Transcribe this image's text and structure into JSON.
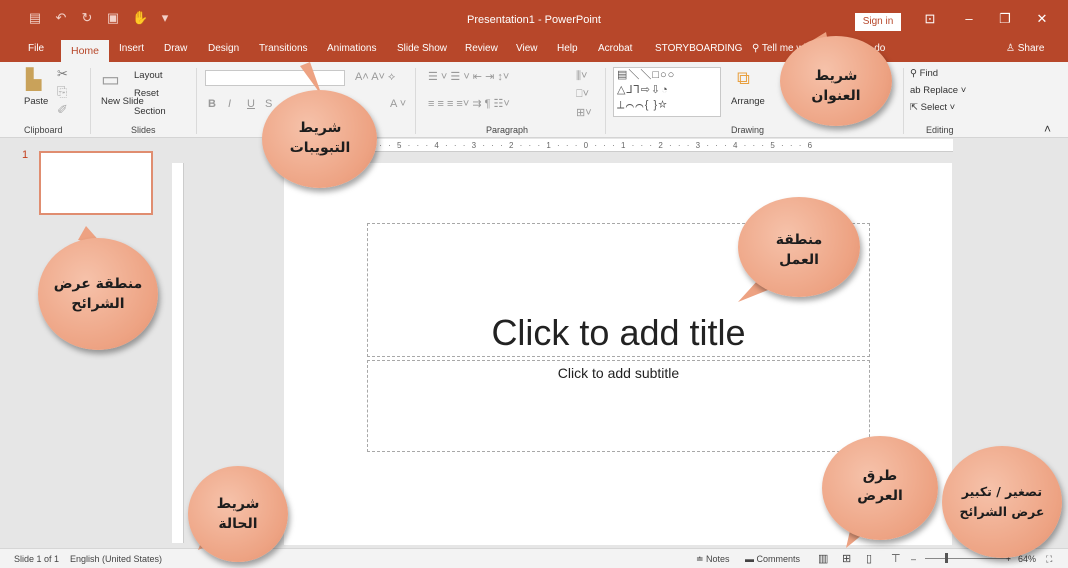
{
  "titlebar": {
    "title": "Presentation1 - PowerPoint",
    "signin": "Sign in",
    "qat_icons": [
      "save-icon",
      "undo-icon",
      "redo-icon",
      "present-icon",
      "touch-mode-icon",
      "customize-icon"
    ]
  },
  "tabs": [
    "File",
    "Home",
    "Insert",
    "Draw",
    "Design",
    "Transitions",
    "Animations",
    "Slide Show",
    "Review",
    "View",
    "Help",
    "Acrobat",
    "STORYBOARDING"
  ],
  "tellme": "Tell me what you want to do",
  "share": "Share",
  "ribbon": {
    "clipboard": {
      "paste": "Paste",
      "label": "Clipboard"
    },
    "slides": {
      "new_slide": "New Slide",
      "layout": "Layout",
      "reset": "Reset",
      "section": "Section",
      "label": "Slides"
    },
    "font": {
      "bold": "B",
      "italic": "I",
      "underline": "U",
      "strike": "S"
    },
    "paragraph": {
      "label": "Paragraph"
    },
    "drawing": {
      "arrange": "Arrange",
      "label": "Drawing"
    },
    "editing": {
      "find": "Find",
      "replace": "Replace",
      "select": "Select",
      "label": "Editing"
    }
  },
  "ruler_text": "8 · · · 7 · · · 6 · · · 5 · · · 4 · · · 3 · · · 2 · · · 1 · · · 0 · · · 1 · · · 2 · · · 3 · · · 4 · · · 5 · · · 6",
  "thumbnail": {
    "number": "1"
  },
  "slide": {
    "title_placeholder": "Click to add title",
    "subtitle_placeholder": "Click to add subtitle"
  },
  "statusbar": {
    "slide_info": "Slide 1 of 1",
    "language": "English (United States)",
    "notes": "Notes",
    "comments": "Comments",
    "zoom": "64%"
  },
  "callouts": {
    "title_bar": "شريط العنوان",
    "tabs_bar": "شريط التبويبات",
    "slides_area": "منطقة عرض الشرائح",
    "work_area": "منطقة العمل",
    "status_bar": "شريط الحالة",
    "view_modes": "طرق العرض",
    "zoom": "تصغير / تكبير عرض الشرائح"
  },
  "colors": {
    "accent": "#b7472a",
    "bubble": "#eda282"
  }
}
